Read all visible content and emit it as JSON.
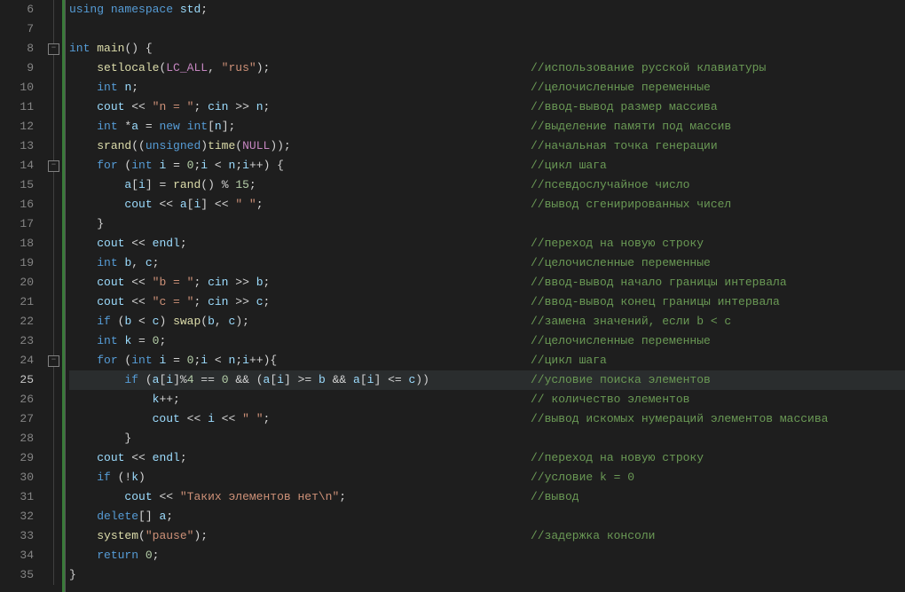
{
  "lines": {
    "start": 6,
    "end": 35,
    "active": 25,
    "foldMarkers": [
      8,
      14,
      24
    ]
  },
  "code": {
    "l6": {
      "tokens": [
        [
          "kw",
          "using"
        ],
        [
          "op",
          " "
        ],
        [
          "kw",
          "namespace"
        ],
        [
          "op",
          " "
        ],
        [
          "id",
          "std"
        ],
        [
          "pun",
          ";"
        ]
      ]
    },
    "l7": {
      "tokens": []
    },
    "l8": {
      "tokens": [
        [
          "kw",
          "int"
        ],
        [
          "op",
          " "
        ],
        [
          "fn",
          "main"
        ],
        [
          "pun",
          "() {"
        ]
      ]
    },
    "l9": {
      "indent": 1,
      "tokens": [
        [
          "fn",
          "setlocale"
        ],
        [
          "pun",
          "("
        ],
        [
          "macro",
          "LC_ALL"
        ],
        [
          "pun",
          ", "
        ],
        [
          "str",
          "\"rus\""
        ],
        [
          "pun",
          ");"
        ]
      ],
      "comment": "//использование русской клавиатуры"
    },
    "l10": {
      "indent": 1,
      "tokens": [
        [
          "kw",
          "int"
        ],
        [
          "op",
          " "
        ],
        [
          "id",
          "n"
        ],
        [
          "pun",
          ";"
        ]
      ],
      "comment": "//целочисленные переменные"
    },
    "l11": {
      "indent": 1,
      "tokens": [
        [
          "id",
          "cout"
        ],
        [
          "op",
          " << "
        ],
        [
          "str",
          "\"n = \""
        ],
        [
          "pun",
          "; "
        ],
        [
          "id",
          "cin"
        ],
        [
          "op",
          " >> "
        ],
        [
          "id",
          "n"
        ],
        [
          "pun",
          ";"
        ]
      ],
      "comment": "//ввод-вывод размер массива"
    },
    "l12": {
      "indent": 1,
      "tokens": [
        [
          "kw",
          "int"
        ],
        [
          "op",
          " *"
        ],
        [
          "id",
          "a"
        ],
        [
          "op",
          " = "
        ],
        [
          "kw",
          "new"
        ],
        [
          "op",
          " "
        ],
        [
          "kw",
          "int"
        ],
        [
          "pun",
          "["
        ],
        [
          "id",
          "n"
        ],
        [
          "pun",
          "];"
        ]
      ],
      "comment": "//выделение памяти под массив"
    },
    "l13": {
      "indent": 1,
      "tokens": [
        [
          "fn",
          "srand"
        ],
        [
          "pun",
          "(("
        ],
        [
          "kw",
          "unsigned"
        ],
        [
          "pun",
          ")"
        ],
        [
          "fn",
          "time"
        ],
        [
          "pun",
          "("
        ],
        [
          "null",
          "NULL"
        ],
        [
          "pun",
          "));"
        ]
      ],
      "comment": "//начальная точка генерации"
    },
    "l14": {
      "indent": 1,
      "tokens": [
        [
          "kw",
          "for"
        ],
        [
          "op",
          " ("
        ],
        [
          "kw",
          "int"
        ],
        [
          "op",
          " "
        ],
        [
          "id",
          "i"
        ],
        [
          "op",
          " = "
        ],
        [
          "num",
          "0"
        ],
        [
          "pun",
          ";"
        ],
        [
          "id",
          "i"
        ],
        [
          "op",
          " < "
        ],
        [
          "id",
          "n"
        ],
        [
          "pun",
          ";"
        ],
        [
          "id",
          "i"
        ],
        [
          "op",
          "++"
        ],
        [
          "pun",
          ") {"
        ]
      ],
      "comment": "//цикл шага"
    },
    "l15": {
      "indent": 2,
      "tokens": [
        [
          "id",
          "a"
        ],
        [
          "pun",
          "["
        ],
        [
          "id",
          "i"
        ],
        [
          "pun",
          "] = "
        ],
        [
          "fn",
          "rand"
        ],
        [
          "pun",
          "() % "
        ],
        [
          "num",
          "15"
        ],
        [
          "pun",
          ";"
        ]
      ],
      "comment": "//псевдослучайное число"
    },
    "l16": {
      "indent": 2,
      "tokens": [
        [
          "id",
          "cout"
        ],
        [
          "op",
          " << "
        ],
        [
          "id",
          "a"
        ],
        [
          "pun",
          "["
        ],
        [
          "id",
          "i"
        ],
        [
          "pun",
          "] << "
        ],
        [
          "str",
          "\" \""
        ],
        [
          "pun",
          ";"
        ]
      ],
      "comment": "//вывод сгенирированных чисел"
    },
    "l17": {
      "indent": 1,
      "tokens": [
        [
          "pun",
          "}"
        ]
      ]
    },
    "l18": {
      "indent": 1,
      "tokens": [
        [
          "id",
          "cout"
        ],
        [
          "op",
          " << "
        ],
        [
          "id",
          "endl"
        ],
        [
          "pun",
          ";"
        ]
      ],
      "comment": "//переход на новую строку"
    },
    "l19": {
      "indent": 1,
      "tokens": [
        [
          "kw",
          "int"
        ],
        [
          "op",
          " "
        ],
        [
          "id",
          "b"
        ],
        [
          "pun",
          ", "
        ],
        [
          "id",
          "c"
        ],
        [
          "pun",
          ";"
        ]
      ],
      "comment": "//целочисленные переменные"
    },
    "l20": {
      "indent": 1,
      "tokens": [
        [
          "id",
          "cout"
        ],
        [
          "op",
          " << "
        ],
        [
          "str",
          "\"b = \""
        ],
        [
          "pun",
          "; "
        ],
        [
          "id",
          "cin"
        ],
        [
          "op",
          " >> "
        ],
        [
          "id",
          "b"
        ],
        [
          "pun",
          ";"
        ]
      ],
      "comment": "//ввод-вывод начало границы интервала"
    },
    "l21": {
      "indent": 1,
      "tokens": [
        [
          "id",
          "cout"
        ],
        [
          "op",
          " << "
        ],
        [
          "str",
          "\"c = \""
        ],
        [
          "pun",
          "; "
        ],
        [
          "id",
          "cin"
        ],
        [
          "op",
          " >> "
        ],
        [
          "id",
          "c"
        ],
        [
          "pun",
          ";"
        ]
      ],
      "comment": "//ввод-вывод конец границы интервала"
    },
    "l22": {
      "indent": 1,
      "tokens": [
        [
          "kw",
          "if"
        ],
        [
          "op",
          " ("
        ],
        [
          "id",
          "b"
        ],
        [
          "op",
          " < "
        ],
        [
          "id",
          "c"
        ],
        [
          "pun",
          ") "
        ],
        [
          "fn",
          "swap"
        ],
        [
          "pun",
          "("
        ],
        [
          "id",
          "b"
        ],
        [
          "pun",
          ", "
        ],
        [
          "id",
          "c"
        ],
        [
          "pun",
          ");"
        ]
      ],
      "comment": "//замена значений, если b < c"
    },
    "l23": {
      "indent": 1,
      "tokens": [
        [
          "kw",
          "int"
        ],
        [
          "op",
          " "
        ],
        [
          "id",
          "k"
        ],
        [
          "op",
          " = "
        ],
        [
          "num",
          "0"
        ],
        [
          "pun",
          ";"
        ]
      ],
      "comment": "//целочисленные переменные"
    },
    "l24": {
      "indent": 1,
      "tokens": [
        [
          "kw",
          "for"
        ],
        [
          "op",
          " ("
        ],
        [
          "kw",
          "int"
        ],
        [
          "op",
          " "
        ],
        [
          "id",
          "i"
        ],
        [
          "op",
          " = "
        ],
        [
          "num",
          "0"
        ],
        [
          "pun",
          ";"
        ],
        [
          "id",
          "i"
        ],
        [
          "op",
          " < "
        ],
        [
          "id",
          "n"
        ],
        [
          "pun",
          ";"
        ],
        [
          "id",
          "i"
        ],
        [
          "op",
          "++"
        ],
        [
          "pun",
          "){"
        ]
      ],
      "comment": "//цикл шага"
    },
    "l25": {
      "indent": 2,
      "tokens": [
        [
          "kw",
          "if"
        ],
        [
          "op",
          " ("
        ],
        [
          "id",
          "a"
        ],
        [
          "pun",
          "["
        ],
        [
          "id",
          "i"
        ],
        [
          "pun",
          "]%"
        ],
        [
          "num",
          "4"
        ],
        [
          "op",
          " == "
        ],
        [
          "num",
          "0"
        ],
        [
          "op",
          " && ("
        ],
        [
          "id",
          "a"
        ],
        [
          "pun",
          "["
        ],
        [
          "id",
          "i"
        ],
        [
          "pun",
          "] >= "
        ],
        [
          "id",
          "b"
        ],
        [
          "op",
          " && "
        ],
        [
          "id",
          "a"
        ],
        [
          "pun",
          "["
        ],
        [
          "id",
          "i"
        ],
        [
          "pun",
          "] <= "
        ],
        [
          "id",
          "c"
        ],
        [
          "pun",
          "))"
        ]
      ],
      "comment": "//условие поиска элементов"
    },
    "l26": {
      "indent": 3,
      "tokens": [
        [
          "id",
          "k"
        ],
        [
          "op",
          "++"
        ],
        [
          "pun",
          ";"
        ]
      ],
      "comment": "// количество элементов"
    },
    "l27": {
      "indent": 3,
      "tokens": [
        [
          "id",
          "cout"
        ],
        [
          "op",
          " << "
        ],
        [
          "id",
          "i"
        ],
        [
          "op",
          " << "
        ],
        [
          "str",
          "\" \""
        ],
        [
          "pun",
          ";"
        ]
      ],
      "comment": "//вывод искомых нумераций элементов массива"
    },
    "l28": {
      "indent": 2,
      "tokens": [
        [
          "pun",
          "}"
        ]
      ]
    },
    "l29": {
      "indent": 1,
      "tokens": [
        [
          "id",
          "cout"
        ],
        [
          "op",
          " << "
        ],
        [
          "id",
          "endl"
        ],
        [
          "pun",
          ";"
        ]
      ],
      "comment": "//переход на новую строку"
    },
    "l30": {
      "indent": 1,
      "tokens": [
        [
          "kw",
          "if"
        ],
        [
          "op",
          " (!"
        ],
        [
          "id",
          "k"
        ],
        [
          "pun",
          ")"
        ]
      ],
      "comment": "//условие k = 0"
    },
    "l31": {
      "indent": 2,
      "tokens": [
        [
          "id",
          "cout"
        ],
        [
          "op",
          " << "
        ],
        [
          "str",
          "\"Таких элементов нет\\n\""
        ],
        [
          "pun",
          ";"
        ]
      ],
      "comment": "//вывод"
    },
    "l32": {
      "indent": 1,
      "tokens": [
        [
          "kw",
          "delete"
        ],
        [
          "pun",
          "[] "
        ],
        [
          "id",
          "a"
        ],
        [
          "pun",
          ";"
        ]
      ]
    },
    "l33": {
      "indent": 1,
      "tokens": [
        [
          "fn",
          "system"
        ],
        [
          "pun",
          "("
        ],
        [
          "str",
          "\"pause\""
        ],
        [
          "pun",
          ");"
        ]
      ],
      "comment": "//задержка консоли"
    },
    "l34": {
      "indent": 1,
      "tokens": [
        [
          "kw",
          "return"
        ],
        [
          "op",
          " "
        ],
        [
          "num",
          "0"
        ],
        [
          "pun",
          ";"
        ]
      ]
    },
    "l35": {
      "tokens": [
        [
          "pun",
          "}"
        ]
      ]
    }
  }
}
